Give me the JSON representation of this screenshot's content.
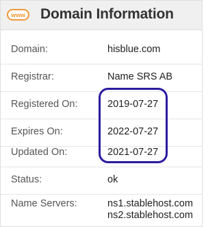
{
  "header": {
    "icon_label": "www",
    "title": "Domain Information"
  },
  "rows": [
    {
      "label": "Domain:",
      "value": "hisblue.com"
    },
    {
      "label": "Registrar:",
      "value": "Name SRS AB"
    },
    {
      "label": "Registered On:",
      "value": "2019-07-27"
    },
    {
      "label": "Expires On:",
      "value": "2022-07-27"
    },
    {
      "label": "Updated On:",
      "value": "2021-07-27"
    },
    {
      "label": "Status:",
      "value": "ok"
    },
    {
      "label": "Name Servers:",
      "values": [
        "ns1.stablehost.com",
        "ns2.stablehost.com"
      ]
    }
  ],
  "colors": {
    "icon_accent": "#f0983a",
    "highlight_outline": "#2a1a9e",
    "header_background": "#f0f0f0"
  }
}
